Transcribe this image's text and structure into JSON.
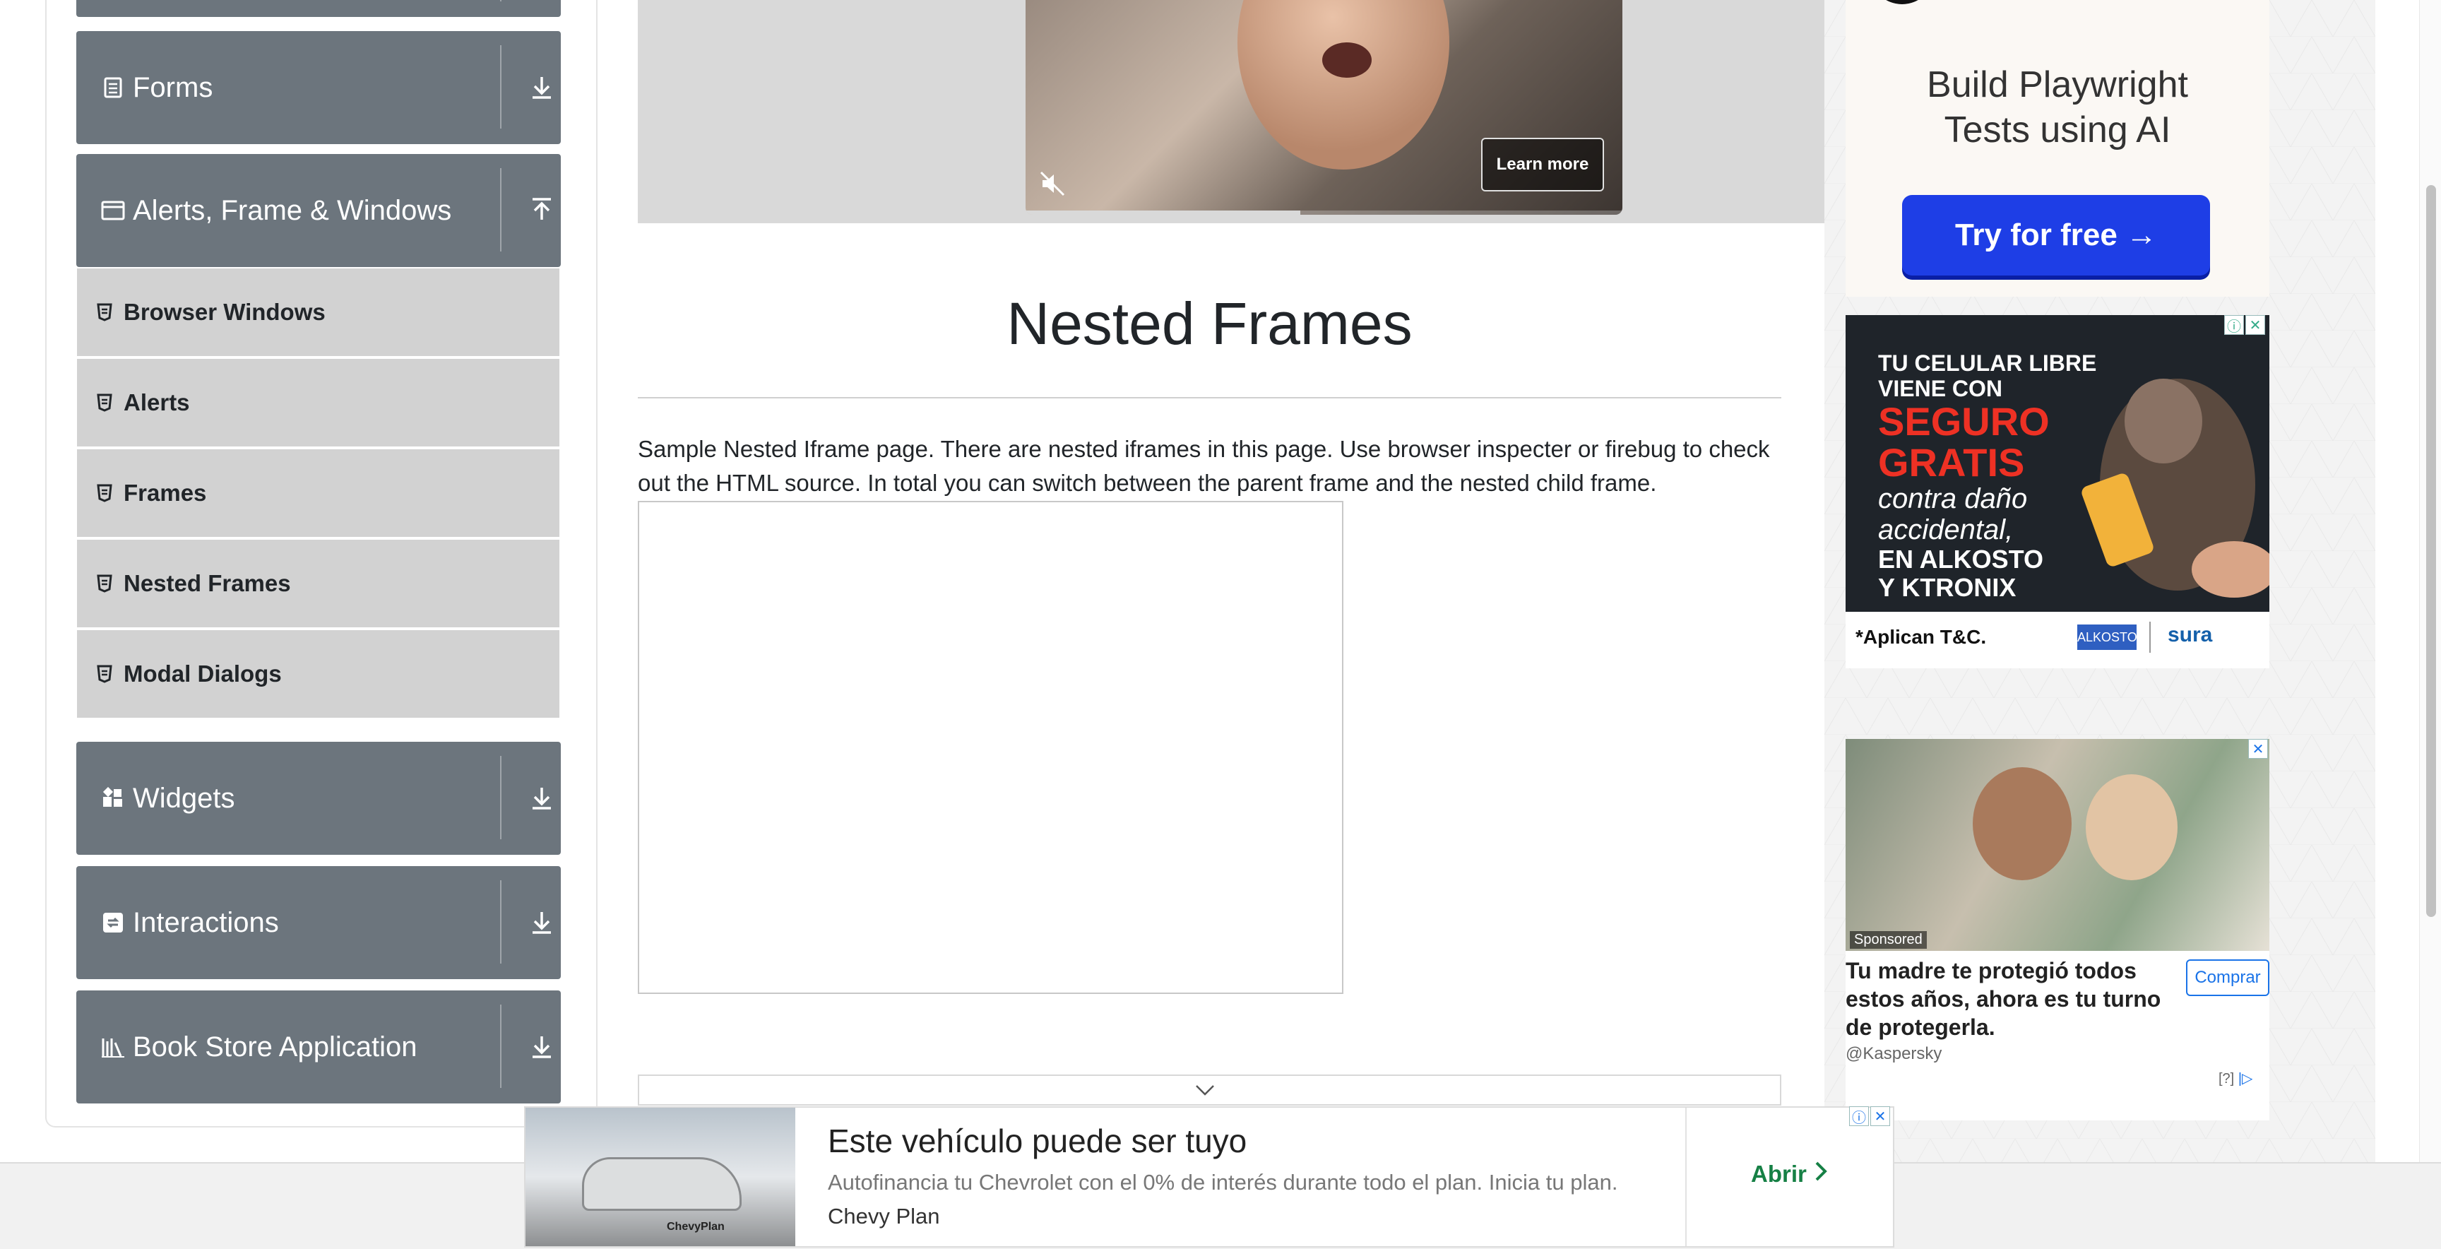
{
  "sidebar": {
    "groups": [
      {
        "label": "Forms",
        "icon": "form-icon",
        "toggle_icon": "download-arrow-icon",
        "expanded": false
      },
      {
        "label": "Alerts, Frame & Windows",
        "icon": "window-icon",
        "toggle_icon": "upload-arrow-icon",
        "expanded": true
      },
      {
        "label": "Widgets",
        "icon": "widgets-icon",
        "toggle_icon": "download-arrow-icon",
        "expanded": false
      },
      {
        "label": "Interactions",
        "icon": "interactions-icon",
        "toggle_icon": "download-arrow-icon",
        "expanded": false
      },
      {
        "label": "Book Store Application",
        "icon": "bookstore-icon",
        "toggle_icon": "download-arrow-icon",
        "expanded": false
      }
    ],
    "items": [
      {
        "label": "Browser Windows"
      },
      {
        "label": "Alerts"
      },
      {
        "label": "Frames"
      },
      {
        "label": "Nested Frames"
      },
      {
        "label": "Modal Dialogs"
      }
    ]
  },
  "video_ad": {
    "learn_more": "Learn more",
    "progress": 0.46
  },
  "main": {
    "title": "Nested Frames",
    "intro": "Sample Nested Iframe page. There are nested iframes in this page. Use browser inspecter or firebug to check out the HTML source. In total you can switch between the parent frame and the nested child frame."
  },
  "ads": {
    "zerostep": {
      "headline_line1": "Build Playwright",
      "headline_line2": "Tests using AI",
      "cta": "Try for free →"
    },
    "alkosto": {
      "line1": "TU CELULAR LIBRE",
      "line2": "VIENE CON",
      "line3": "SEGURO",
      "line4": "GRATIS",
      "line5": "contra daño",
      "line6": "accidental,",
      "line7": "EN ALKOSTO",
      "line8": "Y KTRONIX",
      "terms": "*Aplican T&C.",
      "partner": "sura"
    },
    "kaspersky": {
      "sponsored": "Sponsored",
      "headline": "Tu madre te protegió todos estos años, ahora es tu turno de protegerla.",
      "cta": "Comprar",
      "brand": "@Kaspersky",
      "help": "[?]"
    },
    "chevrolet": {
      "headline": "Este vehículo puede ser tuyo",
      "description": "Autofinancia tu Chevrolet con el 0% de interés durante todo el plan. Inicia tu plan.",
      "brand": "Chevy Plan",
      "cta": "Abrir",
      "image_tag": "ChevyPlan"
    }
  },
  "colors": {
    "sidebar_group": "#6c757d",
    "sidebar_item": "#d2d2d2",
    "cta_blue": "#1e3ee6",
    "ad_red": "#ee3124",
    "abrir_green": "#168045"
  }
}
